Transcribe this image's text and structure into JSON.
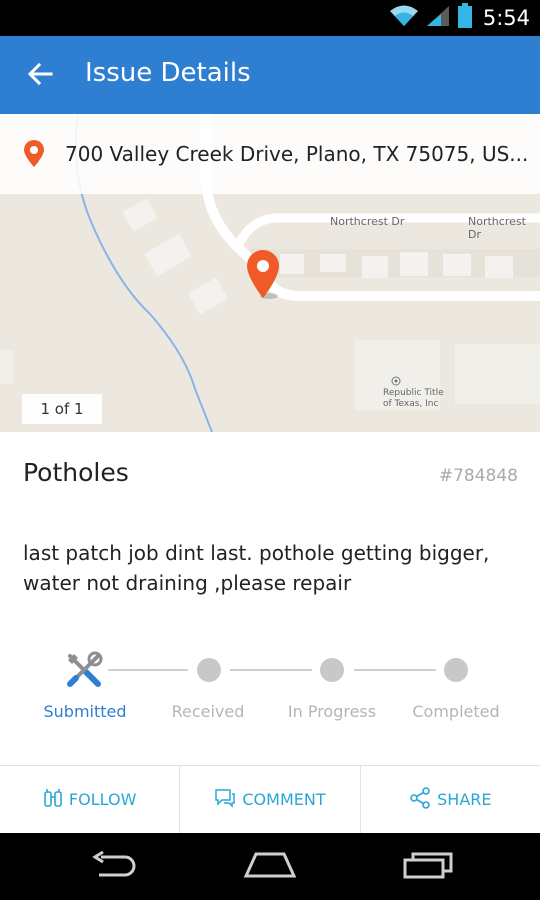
{
  "status_bar": {
    "time": "5:54"
  },
  "app_bar": {
    "title": "Issue Details"
  },
  "map": {
    "address": "700 Valley Creek Drive, Plano, TX 75075, US...",
    "street_labels": [
      "Northcrest Dr",
      "Northcrest Dr"
    ],
    "poi_label_line1": "Republic Title",
    "poi_label_line2": "of Texas, Inc",
    "counter": "1 of 1"
  },
  "issue": {
    "title": "Potholes",
    "id": "#784848",
    "description": "last patch job dint last. pothole getting bigger, water not draining ,please repair"
  },
  "progress": {
    "steps": [
      "Submitted",
      "Received",
      "In Progress",
      "Completed"
    ],
    "current_step": 1
  },
  "actions": {
    "follow": "FOLLOW",
    "comment": "COMMENT",
    "share": "SHARE"
  },
  "colors": {
    "app_bar": "#2e7fd1",
    "accent": "#2aa6d6",
    "pin": "#f05a28"
  }
}
